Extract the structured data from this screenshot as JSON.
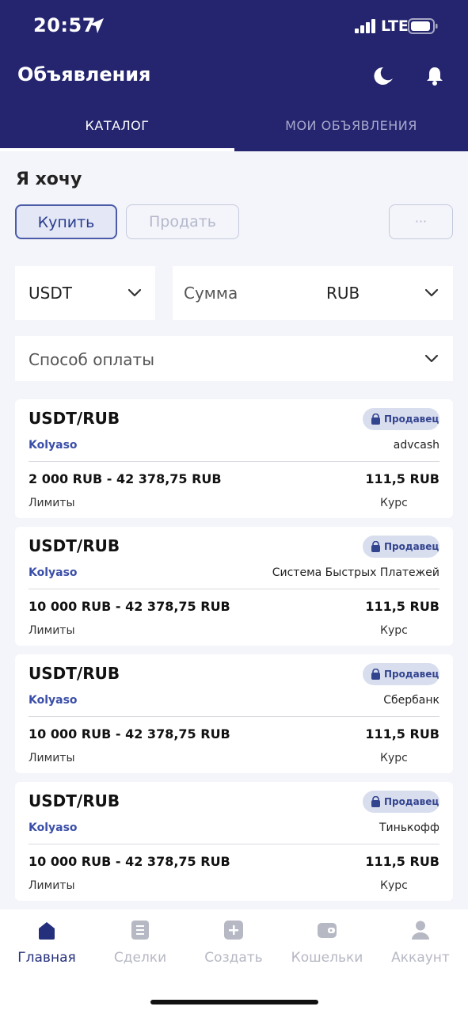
{
  "status_bar": {
    "time": "20:57",
    "network": "LTE"
  },
  "header": {
    "title": "Объявления",
    "tabs": [
      {
        "label": "КАТАЛОГ",
        "active": true
      },
      {
        "label": "МОИ ОБЪЯВЛЕНИЯ",
        "active": false
      }
    ]
  },
  "filters": {
    "want_label": "Я хочу",
    "buy_label": "Купить",
    "sell_label": "Продать",
    "more_label": "···",
    "currency": "USDT",
    "amount_placeholder": "Сумма",
    "fiat": "RUB",
    "payment_placeholder": "Способ оплаты"
  },
  "offers": [
    {
      "pair": "USDT/RUB",
      "badge": "Продавец",
      "user": "Kolyaso",
      "method": "advcash",
      "limits": "2 000 RUB - 42 378,75 RUB",
      "rate": "111,5 RUB",
      "limits_label": "Лимиты",
      "rate_label": "Курс"
    },
    {
      "pair": "USDT/RUB",
      "badge": "Продавец",
      "user": "Kolyaso",
      "method": "Система Быстрых Платежей",
      "limits": "10 000 RUB - 42 378,75 RUB",
      "rate": "111,5 RUB",
      "limits_label": "Лимиты",
      "rate_label": "Курс"
    },
    {
      "pair": "USDT/RUB",
      "badge": "Продавец",
      "user": "Kolyaso",
      "method": "Сбербанк",
      "limits": "10 000 RUB - 42 378,75 RUB",
      "rate": "111,5 RUB",
      "limits_label": "Лимиты",
      "rate_label": "Курс"
    },
    {
      "pair": "USDT/RUB",
      "badge": "Продавец",
      "user": "Kolyaso",
      "method": "Тинькофф",
      "limits": "10 000 RUB - 42 378,75 RUB",
      "rate": "111,5 RUB",
      "limits_label": "Лимиты",
      "rate_label": "Курс"
    }
  ],
  "bottom_nav": [
    {
      "label": "Главная",
      "icon": "home-icon",
      "active": true
    },
    {
      "label": "Сделки",
      "icon": "deals-icon",
      "active": false
    },
    {
      "label": "Создать",
      "icon": "plus-icon",
      "active": false
    },
    {
      "label": "Кошельки",
      "icon": "wallet-icon",
      "active": false
    },
    {
      "label": "Аккаунт",
      "icon": "user-icon",
      "active": false
    }
  ],
  "colors": {
    "header_bg": "#24246f",
    "accent": "#3b4fa8",
    "page_bg": "#f4f5fa"
  }
}
